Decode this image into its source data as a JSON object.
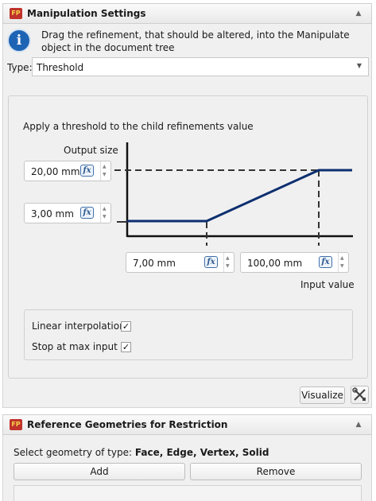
{
  "manipulation_panel": {
    "title": "Manipulation Settings",
    "logo_text": "FP",
    "collapse_icon": "chevron-up-icon",
    "info_text": "Drag the refinement, that should be altered, into the Manipulate object in the document tree",
    "type_label": "Type:",
    "type_value": "Threshold",
    "description": "Apply a threshold to the child refinements value",
    "output_size_label": "Output size",
    "output_max": {
      "value": "20,00 mm"
    },
    "output_min": {
      "value": "3,00 mm"
    },
    "input_min": {
      "value": "7,00 mm"
    },
    "input_max": {
      "value": "100,00 mm"
    },
    "fx_label": "fx",
    "input_value_label": "Input value",
    "linear_interpolation": {
      "label": "Linear interpolation",
      "checked": true
    },
    "stop_at_max_input": {
      "label": "Stop at max input",
      "checked": true
    },
    "checkmark": "✓",
    "visualize_button": "Visualize",
    "curve_color": "#0d2f70"
  },
  "reference_panel": {
    "title": "Reference Geometries for Restriction",
    "logo_text": "FP",
    "collapse_icon": "chevron-up-icon",
    "select_prefix": "Select geometry of type:",
    "select_types": "Face, Edge, Vertex, Solid",
    "add_button": "Add",
    "remove_button": "Remove"
  }
}
